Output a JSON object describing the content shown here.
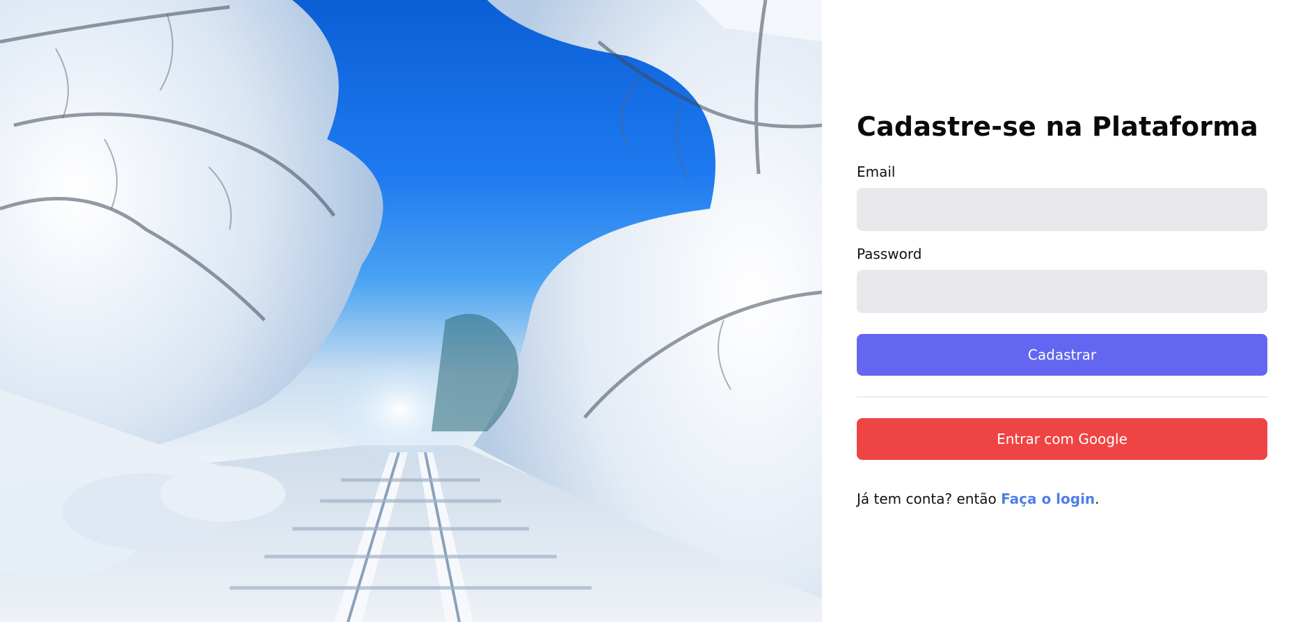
{
  "hero": {
    "image_desc_icon": "snowy-railway-photo"
  },
  "form": {
    "title": "Cadastre-se na Plataforma",
    "email_label": "Email",
    "email_value": "",
    "password_label": "Password",
    "password_value": "",
    "submit_label": "Cadastrar",
    "google_label": "Entrar com Google",
    "footer_prefix": "Já tem conta? então ",
    "footer_link": "Faça o login",
    "footer_suffix": "."
  },
  "colors": {
    "primary": "#6366f1",
    "google": "#ef4444",
    "link": "#4f7de8",
    "input_bg": "#e8e8ec"
  }
}
